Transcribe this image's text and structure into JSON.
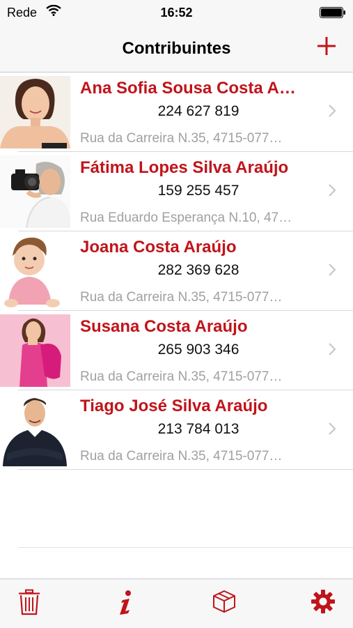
{
  "status_bar": {
    "carrier": "Rede",
    "time": "16:52"
  },
  "nav": {
    "title": "Contribuintes",
    "add_icon": "plus-icon"
  },
  "contacts": [
    {
      "name": "Ana Sofia Sousa Costa A…",
      "nif": "224 627 819",
      "address": "Rua da Carreira N.35, 4715-077…"
    },
    {
      "name": "Fátima Lopes Silva Araújo",
      "nif": "159 255 457",
      "address": "Rua Eduardo Esperança N.10, 47…"
    },
    {
      "name": "Joana Costa Araújo",
      "nif": "282 369 628",
      "address": "Rua da Carreira N.35, 4715-077…"
    },
    {
      "name": "Susana Costa Araújo",
      "nif": "265 903 346",
      "address": "Rua da Carreira N.35, 4715-077…"
    },
    {
      "name": "Tiago José Silva Araújo",
      "nif": "213 784 013",
      "address": "Rua da Carreira N.35, 4715-077…"
    }
  ],
  "tab_bar": {
    "items": [
      "trash-icon",
      "info-icon",
      "box-icon",
      "gear-icon"
    ]
  },
  "colors": {
    "accent": "#c0141b",
    "bar_background": "#f7f7f7",
    "secondary_text": "#a0a0a4"
  }
}
